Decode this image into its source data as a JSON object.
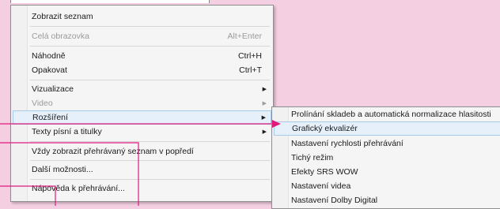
{
  "menu": {
    "items": [
      {
        "label": "Zobrazit seznam",
        "shortcut": "",
        "submenu": false,
        "enabled": true
      },
      {
        "label": "Celá obrazovka",
        "shortcut": "Alt+Enter",
        "submenu": false,
        "enabled": false
      },
      {
        "label": "Náhodně",
        "shortcut": "Ctrl+H",
        "submenu": false,
        "enabled": true
      },
      {
        "label": "Opakovat",
        "shortcut": "Ctrl+T",
        "submenu": false,
        "enabled": true
      },
      {
        "label": "Vizualizace",
        "shortcut": "",
        "submenu": true,
        "enabled": true
      },
      {
        "label": "Video",
        "shortcut": "",
        "submenu": true,
        "enabled": false
      },
      {
        "label": "Rozšíření",
        "shortcut": "",
        "submenu": true,
        "enabled": true,
        "highlighted": true
      },
      {
        "label": "Texty písní a titulky",
        "shortcut": "",
        "submenu": true,
        "enabled": true
      },
      {
        "label": "Vždy zobrazit přehrávaný seznam v popředí",
        "shortcut": "",
        "submenu": false,
        "enabled": true
      },
      {
        "label": "Další možnosti...",
        "shortcut": "",
        "submenu": false,
        "enabled": true
      },
      {
        "label": "Nápověda k přehrávání...",
        "shortcut": "",
        "submenu": false,
        "enabled": true
      }
    ]
  },
  "submenu": {
    "items": [
      {
        "label": "Prolínání skladeb a automatická normalizace hlasitosti"
      },
      {
        "label": "Grafický ekvalizér",
        "highlighted": true
      },
      {
        "label": "Nastavení rychlosti přehrávání"
      },
      {
        "label": "Tichý režim"
      },
      {
        "label": "Efekty SRS WOW"
      },
      {
        "label": "Nastavení videa"
      },
      {
        "label": "Nastavení Dolby Digital"
      }
    ]
  },
  "icons": {
    "submenu_arrow": "submenu-arrow-icon",
    "callout_arrow": "callout-arrow-icon"
  },
  "colors": {
    "background": "#f4cfe2",
    "callout": "#e0197d",
    "highlight": "#e5f0fb"
  }
}
